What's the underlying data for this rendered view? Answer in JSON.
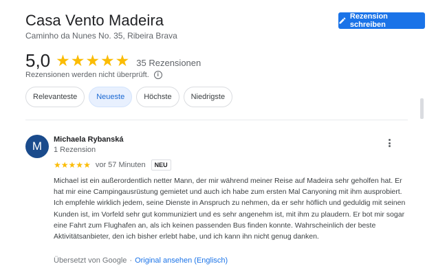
{
  "place": {
    "name": "Casa Vento Madeira",
    "address": "Caminho da Nunes No. 35, Ribeira Brava"
  },
  "write_review": {
    "label": "Rezension schreiben",
    "icon": "pencil-icon",
    "color": "#1a73e8"
  },
  "rating": {
    "value": "5,0",
    "stars": 5,
    "count_text": "35 Rezensionen",
    "star_color": "#fbbc04",
    "disclaimer": "Rezensionen werden nicht überprüft."
  },
  "sort": {
    "options": [
      "Relevanteste",
      "Neueste",
      "Höchste",
      "Niedrigste"
    ],
    "selected": "Neueste"
  },
  "review": {
    "avatar_letter": "M",
    "avatar_color": "#1a4b8c",
    "author": "Michaela Rybanská",
    "author_meta": "1 Rezension",
    "stars": 5,
    "time": "vor 57 Minuten",
    "badge": "NEU",
    "text": "Michael ist ein außerordentlich netter Mann, der mir während meiner Reise auf Madeira sehr geholfen hat. Er hat mir eine Campingausrüstung gemietet und auch ich habe zum ersten Mal Canyoning mit ihm ausprobiert. Ich empfehle wirklich jedem, seine Dienste in Anspruch zu nehmen, da er sehr höflich und geduldig mit seinen Kunden ist, im Vorfeld sehr gut kommuniziert und es sehr angenehm ist, mit ihm zu plaudern. Er bot mir sogar eine Fahrt zum Flughafen an, als ich keinen passenden Bus finden konnte. Wahrscheinlich der beste Aktivitätsanbieter, den ich bisher erlebt habe, und ich kann ihn nicht genug danken.",
    "translated_by": "Übersetzt von Google",
    "separator": "·",
    "original_link": "Original ansehen (Englisch)"
  }
}
